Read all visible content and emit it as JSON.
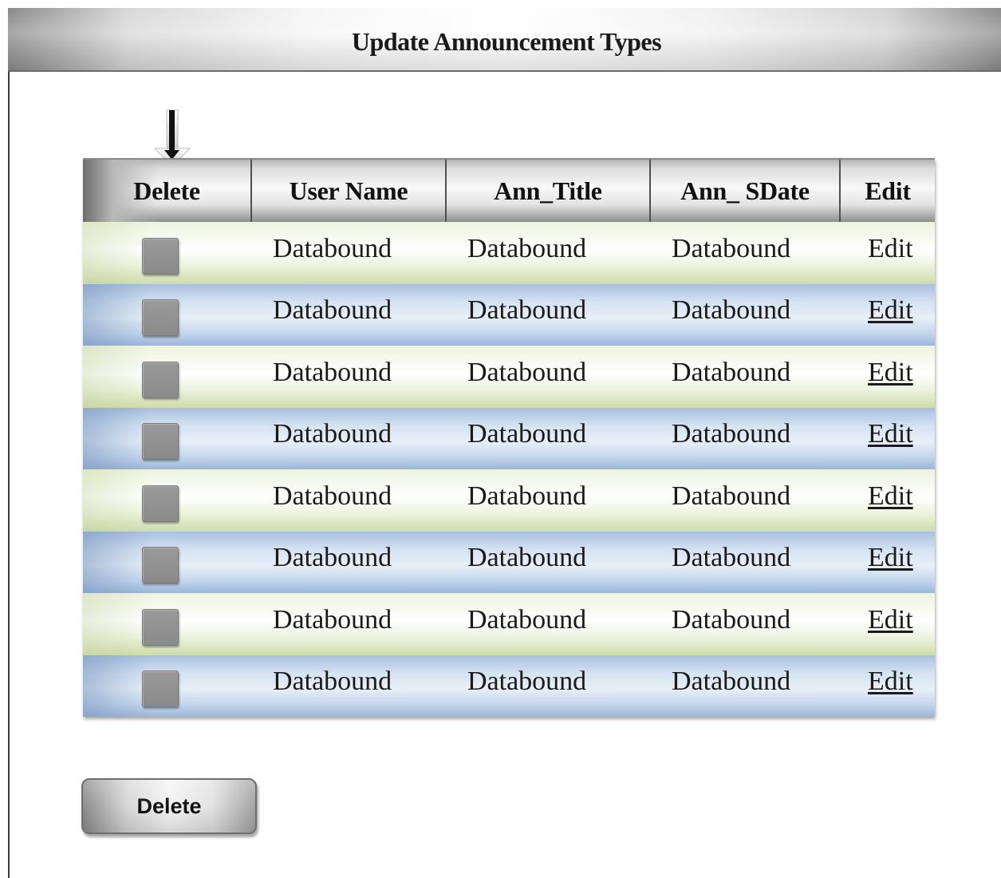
{
  "window": {
    "title": "Update Announcement Types"
  },
  "grid": {
    "columns": [
      "Delete",
      "User Name",
      "Ann_Title",
      "Ann_ SDate",
      "Edit"
    ],
    "rows": [
      {
        "user_name": "Databound",
        "ann_title": "Databound",
        "ann_sdate": "Databound",
        "edit": "Edit",
        "edit_underlined": false,
        "row_style": "green"
      },
      {
        "user_name": "Databound",
        "ann_title": "Databound",
        "ann_sdate": "Databound",
        "edit": "Edit",
        "edit_underlined": true,
        "row_style": "blue"
      },
      {
        "user_name": "Databound",
        "ann_title": "Databound",
        "ann_sdate": "Databound",
        "edit": "Edit",
        "edit_underlined": true,
        "row_style": "green"
      },
      {
        "user_name": "Databound",
        "ann_title": "Databound",
        "ann_sdate": "Databound",
        "edit": "Edit",
        "edit_underlined": true,
        "row_style": "blue"
      },
      {
        "user_name": "Databound",
        "ann_title": "Databound",
        "ann_sdate": "Databound",
        "edit": "Edit",
        "edit_underlined": true,
        "row_style": "green"
      },
      {
        "user_name": "Databound",
        "ann_title": "Databound",
        "ann_sdate": "Databound",
        "edit": "Edit",
        "edit_underlined": true,
        "row_style": "blue"
      },
      {
        "user_name": "Databound",
        "ann_title": "Databound",
        "ann_sdate": "Databound",
        "edit": "Edit",
        "edit_underlined": true,
        "row_style": "green"
      },
      {
        "user_name": "Databound",
        "ann_title": "Databound",
        "ann_sdate": "Databound",
        "edit": "Edit",
        "edit_underlined": true,
        "row_style": "blue"
      }
    ]
  },
  "actions": {
    "delete_label": "Delete"
  },
  "icons": {
    "pointer": "down-arrow-icon",
    "row_select": "checkbox-icon"
  },
  "colors": {
    "row_green": "#eef3de",
    "row_blue": "#c4d6ec",
    "header": "#dcdcdc"
  }
}
